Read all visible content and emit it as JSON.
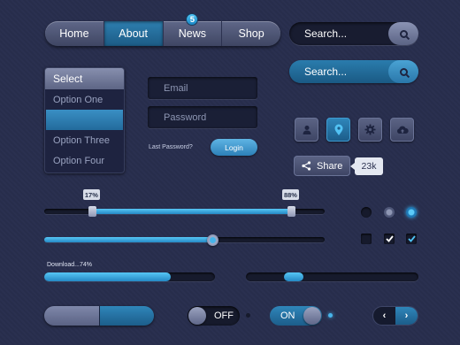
{
  "nav": {
    "items": [
      {
        "label": "Home"
      },
      {
        "label": "About"
      },
      {
        "label": "News",
        "badge": "5"
      },
      {
        "label": "Shop"
      }
    ]
  },
  "search_dark": {
    "placeholder": "Search...",
    "icon": "search-icon"
  },
  "search_blue": {
    "placeholder": "Search...",
    "icon": "search-icon"
  },
  "select": {
    "header": "Select",
    "options": [
      "Option One",
      "",
      "Option Three",
      "Option Four"
    ]
  },
  "form": {
    "email_placeholder": "Email",
    "password_placeholder": "Password",
    "lost_password": "Last Password?",
    "login_label": "Login"
  },
  "icon_buttons": [
    "user-icon",
    "location-pin-icon",
    "gear-icon",
    "cloud-upload-icon"
  ],
  "share": {
    "label": "Share",
    "count": "23k"
  },
  "range_slider": {
    "low": "17%",
    "high": "88%"
  },
  "single_slider": {
    "value": 0.6
  },
  "download": {
    "label": "Download...74%",
    "progress": 0.74
  },
  "scroll_track": {
    "position": 0.22
  },
  "toggles": {
    "off_label": "OFF",
    "on_label": "ON"
  },
  "colors": {
    "accent": "#2f86ba",
    "background": "#2a3050",
    "active_light": "#47b4ea"
  }
}
